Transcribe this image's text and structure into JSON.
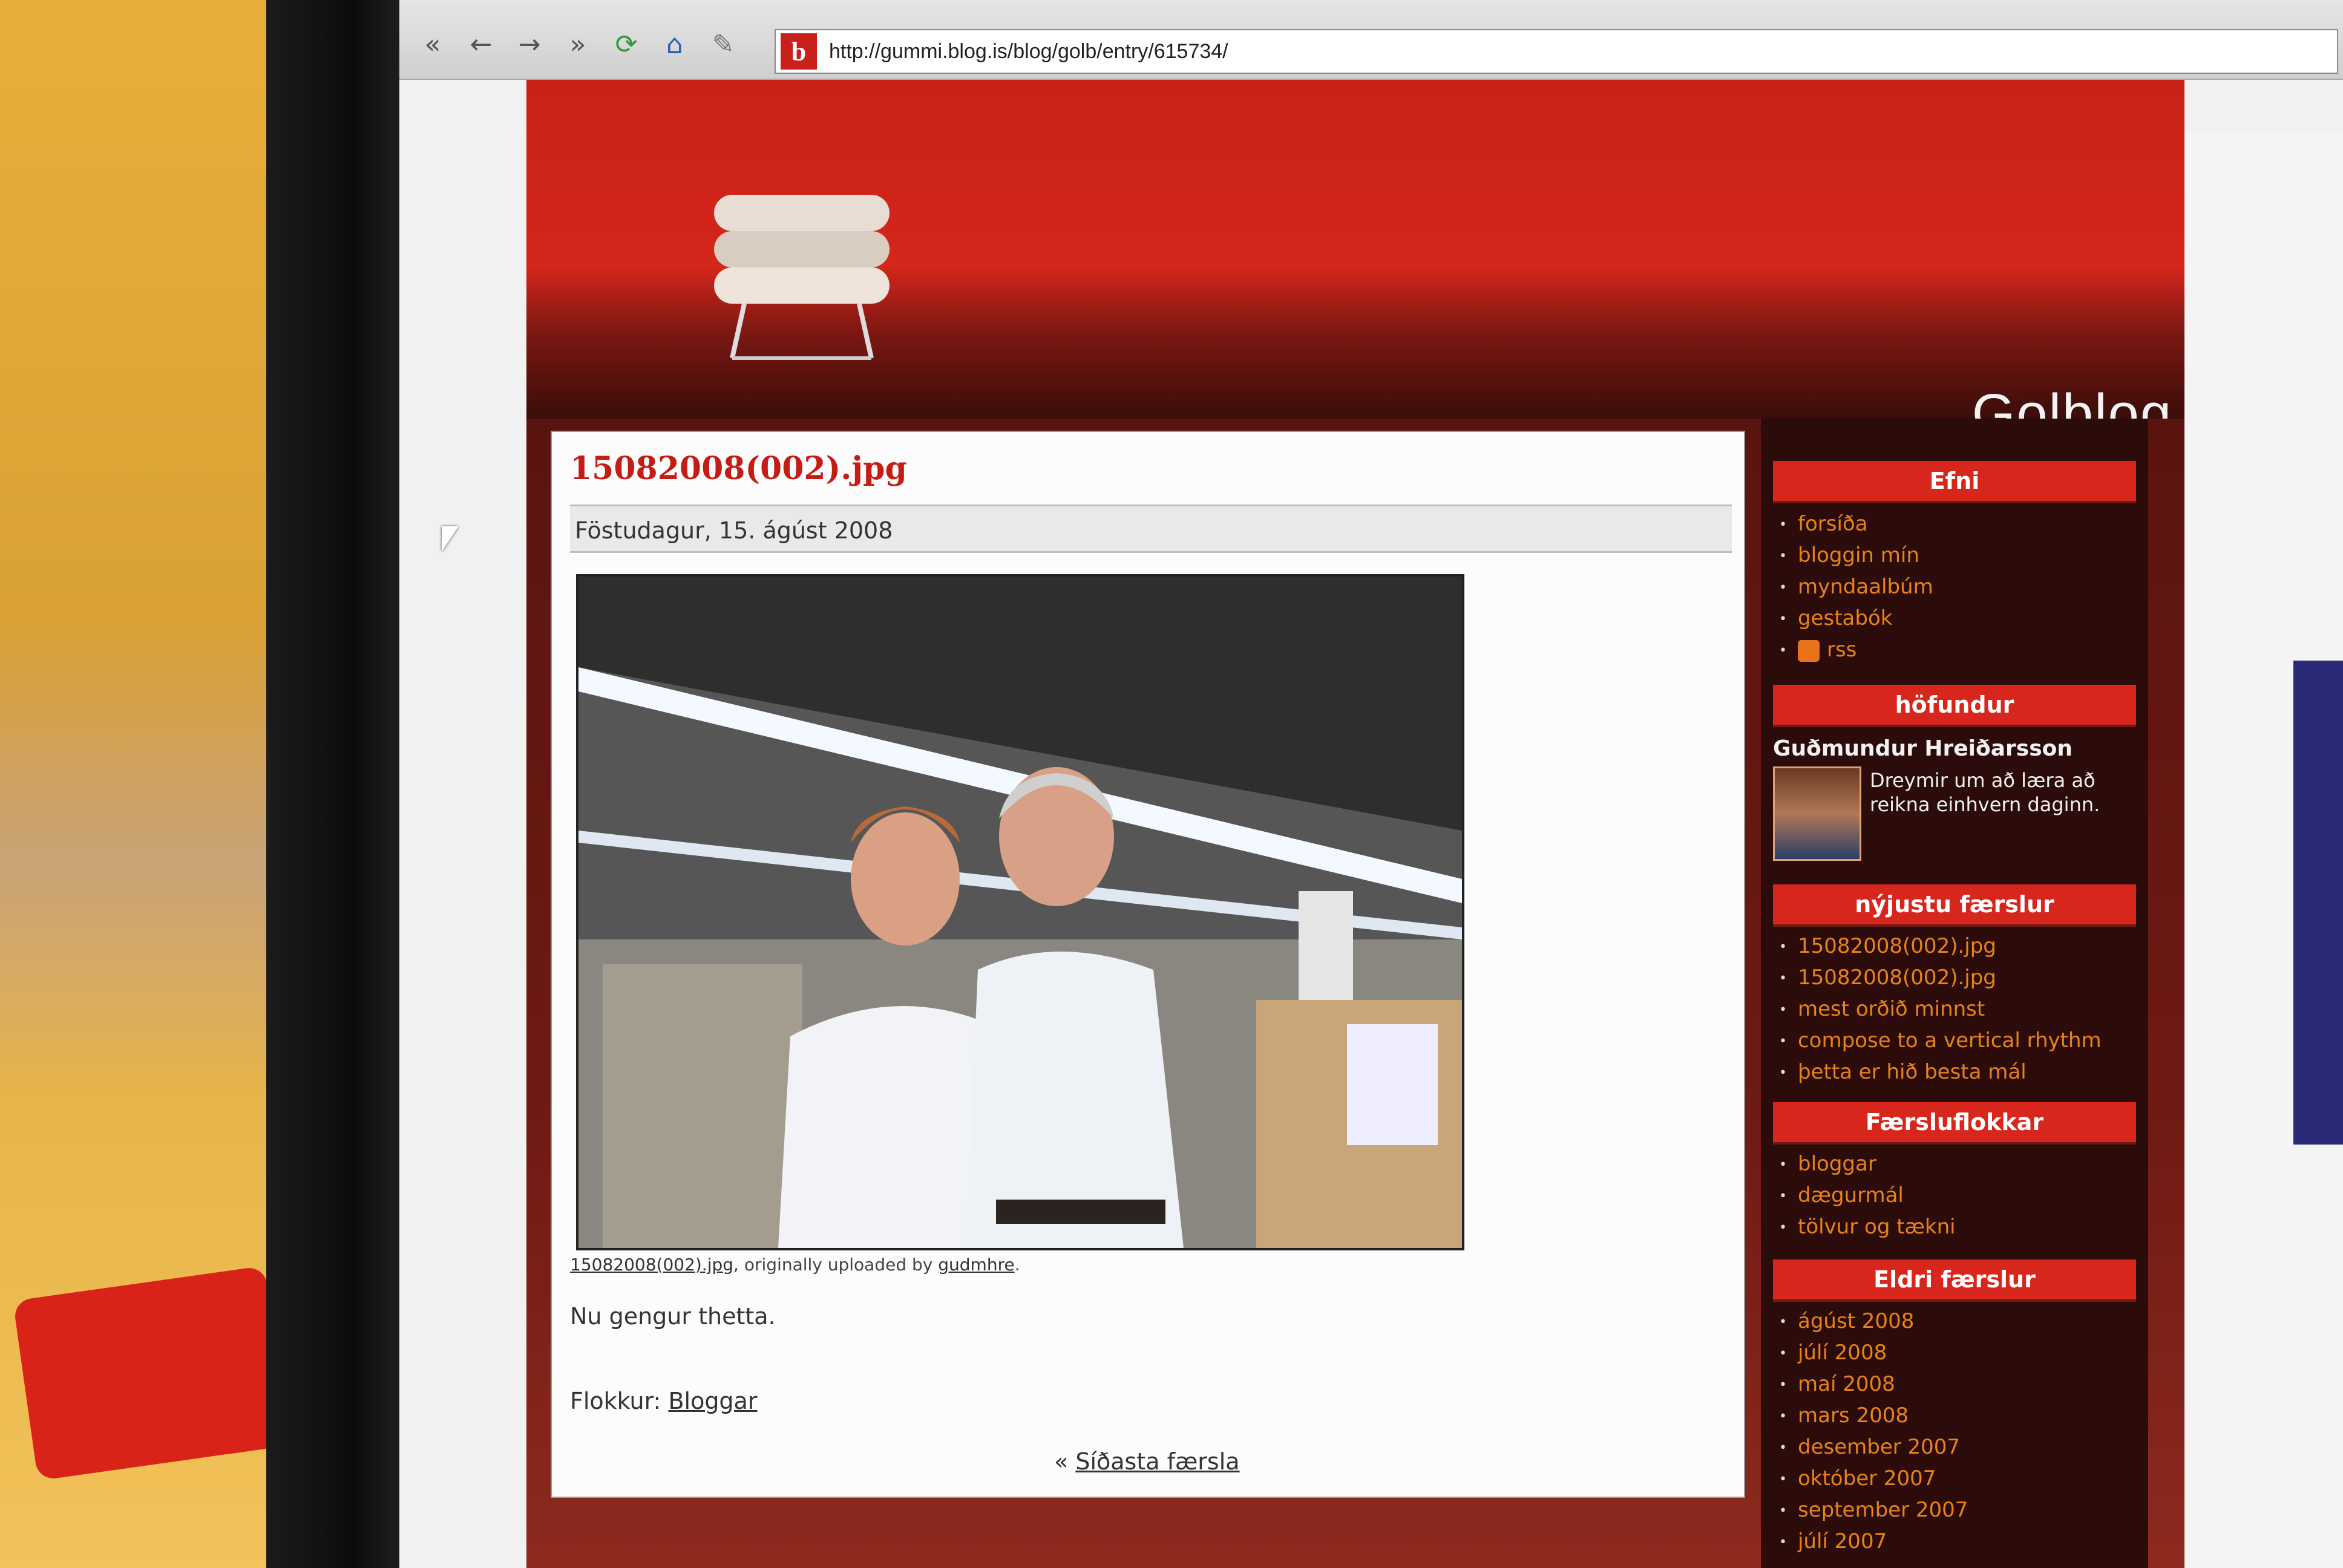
{
  "browser": {
    "url": "http://gummi.blog.is/blog/golb/entry/615734/",
    "site_icon_letter": "b"
  },
  "site": {
    "title": "Golblog"
  },
  "post": {
    "title": "15082008(002).jpg",
    "date": "Föstudagur, 15. ágúst 2008",
    "caption_link": "15082008(002).jpg",
    "caption_mid": ", originally uploaded by ",
    "caption_user": "gudmhre",
    "caption_end": ".",
    "body": "Nu gengur thetta.",
    "category_label": "Flokkur: ",
    "category_value": "Bloggar",
    "prev_prefix": "« ",
    "prev_label": "Síðasta færsla"
  },
  "sidebar": {
    "efni": {
      "heading": "Efni",
      "items": [
        "forsíða",
        "bloggin mín",
        "myndaalbúm",
        "gestabók",
        "rss"
      ]
    },
    "hofundur": {
      "heading": "höfundur",
      "name": "Guðmundur Hreiðarsson",
      "bio": "Dreymir um að læra að reikna einhvern daginn."
    },
    "nyjustu": {
      "heading": "nýjustu færslur",
      "items": [
        "15082008(002).jpg",
        "15082008(002).jpg",
        "mest orðið minnst",
        "compose to a vertical rhythm",
        "þetta er hið besta mál"
      ]
    },
    "faersluflokkar": {
      "heading": "Færsluflokkar",
      "items": [
        "bloggar",
        "dægurmál",
        "tölvur og tækni"
      ]
    },
    "eldri": {
      "heading": "Eldri færslur",
      "items": [
        "ágúst 2008",
        "júlí 2008",
        "maí 2008",
        "mars 2008",
        "desember 2007",
        "október 2007",
        "september 2007",
        "júlí 2007"
      ]
    }
  },
  "colors": {
    "brand_red": "#d7261c",
    "link_orange": "#e9821a",
    "title_red": "#c41d15"
  },
  "icons": [
    "back-icon",
    "forward-icon",
    "reload-icon",
    "home-icon",
    "rss-icon",
    "site-favicon"
  ]
}
